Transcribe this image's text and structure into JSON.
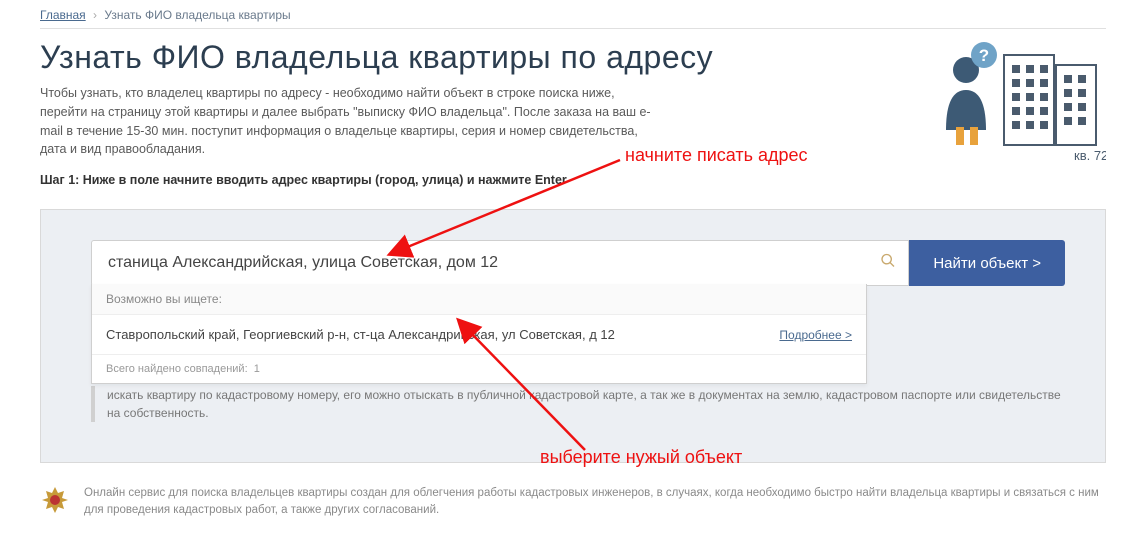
{
  "breadcrumb": {
    "home": "Главная",
    "current": "Узнать ФИО владельца квартиры"
  },
  "title": "Узнать ФИО владельца квартиры по адресу",
  "intro": "Чтобы узнать, кто владелец квартиры по адресу - необходимо найти объект в строке поиска ниже, перейти на страницу этой квартиры и далее выбрать \"выписку ФИО владельца\". После заказа на ваш e-mail в течение 15-30 мин. поступит информация о владельце квартиры, серия и номер свидетельства, дата и вид правообладания.",
  "step": "Шаг 1: Ниже в поле начните вводить адрес квартиры (город, улица) и нажмите Enter",
  "illustration": {
    "apt_label": "кв. 72"
  },
  "search": {
    "value": "станица Александрийская, улица Советская, дом 12",
    "button": "Найти объект >"
  },
  "suggestions": {
    "header": "Возможно вы ищете:",
    "items": [
      {
        "text": "Ставропольский край, Георгиевский р-н, ст-ца Александрийская, ул Советская, д 12",
        "more": "Подробнее >"
      }
    ],
    "footer_prefix": "Всего найдено совпадений:",
    "footer_count": "1"
  },
  "under_text": "искать квартиру по кадастровому номеру, его можно отыскать в публичной кадастровой карте, а так же в документах на землю, кадастровом паспорте или свидетельстве на собственность.",
  "footer_note": "Онлайн сервис для поиска владельцев квартиры создан для облегчения работы кадастровых инженеров, в случаях, когда необходимо быстро найти владельца квартиры и связаться с ним для проведения кадастровых работ, а также других согласований.",
  "annotations": {
    "a1": "начните писать адрес",
    "a2": "выберите нужый объект"
  }
}
